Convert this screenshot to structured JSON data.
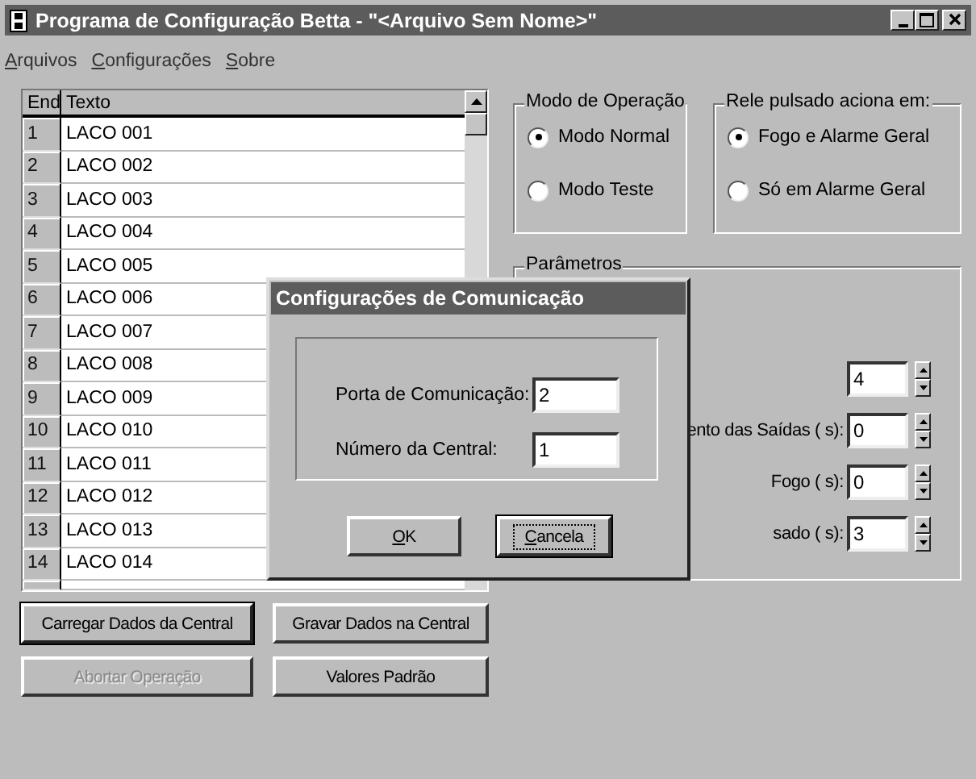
{
  "window": {
    "title": "Programa de Configuração Betta - \"<Arquivo Sem Nome>\""
  },
  "menu": [
    "Arquivos",
    "Configurações",
    "Sobre"
  ],
  "table": {
    "columns": [
      "End",
      "Texto"
    ],
    "rows": [
      {
        "end": "1",
        "texto": "LACO 001"
      },
      {
        "end": "2",
        "texto": "LACO 002"
      },
      {
        "end": "3",
        "texto": "LACO 003"
      },
      {
        "end": "4",
        "texto": "LACO 004"
      },
      {
        "end": "5",
        "texto": "LACO 005"
      },
      {
        "end": "6",
        "texto": "LACO 006"
      },
      {
        "end": "7",
        "texto": "LACO 007"
      },
      {
        "end": "8",
        "texto": "LACO 008"
      },
      {
        "end": "9",
        "texto": "LACO 009"
      },
      {
        "end": "10",
        "texto": "LACO 010"
      },
      {
        "end": "11",
        "texto": "LACO 011"
      },
      {
        "end": "12",
        "texto": "LACO 012"
      },
      {
        "end": "13",
        "texto": "LACO 013"
      },
      {
        "end": "14",
        "texto": "LACO 014"
      }
    ]
  },
  "buttons": [
    {
      "label": "Carregar Dados da Central",
      "disabled": false,
      "default": true
    },
    {
      "label": "Gravar Dados na Central",
      "disabled": false,
      "default": false
    },
    {
      "label": "Abortar Operação",
      "disabled": true,
      "default": false
    },
    {
      "label": "Valores Padrão",
      "disabled": false,
      "default": false
    }
  ],
  "modo_operacao": {
    "title": "Modo de Operação",
    "options": [
      {
        "label": "Modo Normal",
        "selected": true
      },
      {
        "label": "Modo Teste",
        "selected": false
      }
    ]
  },
  "rele_pulsado": {
    "title": "Rele pulsado aciona em:",
    "options": [
      {
        "label": "Fogo e Alarme Geral",
        "selected": true
      },
      {
        "label": "Só em Alarme Geral",
        "selected": false
      }
    ]
  },
  "parametros": {
    "title": "Parâmetros",
    "rows": [
      {
        "value": "4"
      },
      {
        "label": "ento das Saídas ( s):",
        "value": "0"
      },
      {
        "label": "Fogo ( s):",
        "value": "0"
      },
      {
        "label": "sado ( s):",
        "value": "3"
      }
    ]
  },
  "dialog": {
    "title": "Configurações de Comunicação",
    "fields": [
      {
        "label": "Porta de Comunicação:",
        "value": "2"
      },
      {
        "label": "Número da Central:",
        "value": "1"
      }
    ],
    "buttons": [
      {
        "label": "OK",
        "focused": false
      },
      {
        "label": "Cancela",
        "focused": true
      }
    ]
  }
}
